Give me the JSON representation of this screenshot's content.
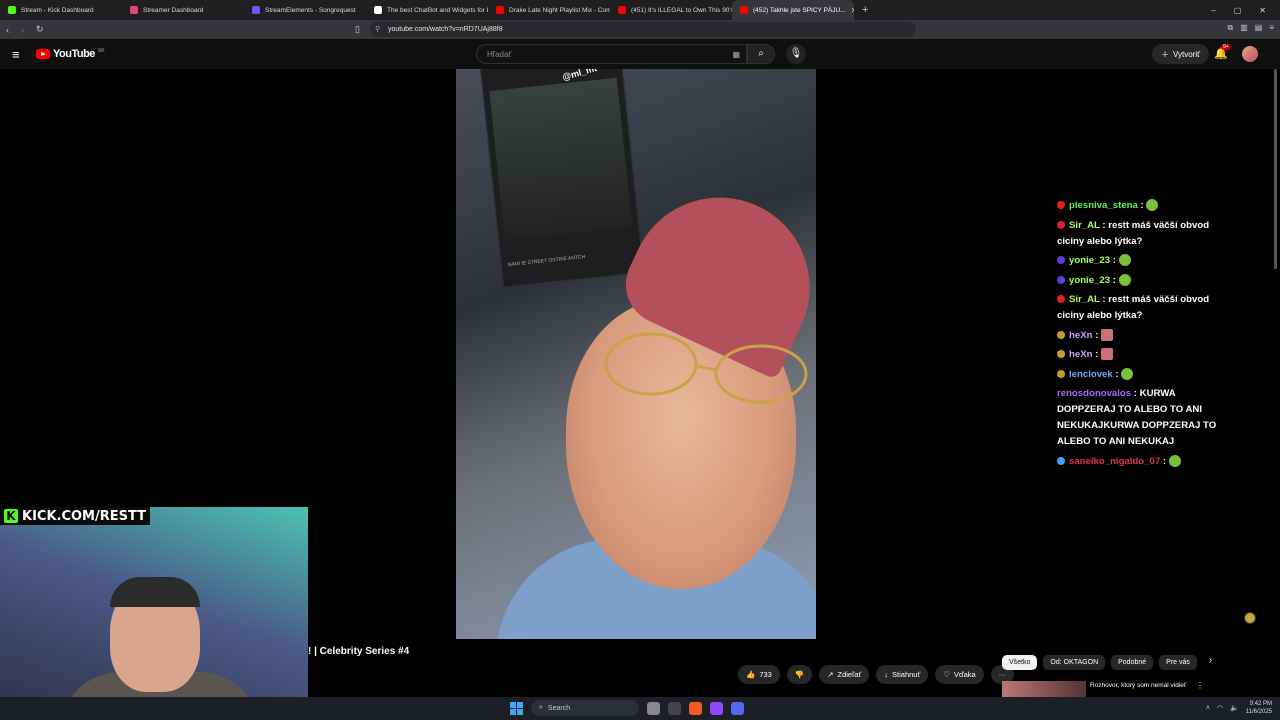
{
  "browser": {
    "tabs": [
      {
        "label": "Stream - Kick Dashboard",
        "color": "#53fc18"
      },
      {
        "label": "Streamer Dashboard",
        "color": "#e0457b"
      },
      {
        "label": "StreamElements - Songrequest",
        "color": "#6b5bff"
      },
      {
        "label": "The best ChatBot and Widgets for K...",
        "color": "#ffffff"
      },
      {
        "label": "Drake Late Night Playlist Mix - Comp...",
        "color": "#ff0000"
      },
      {
        "label": "(451) It's ILLEGAL to Own This 90's H...",
        "color": "#ff0000"
      },
      {
        "label": "(452) Takhle jste SPICY PÁJU...",
        "color": "#ff0000",
        "active": true
      }
    ],
    "new_tab": "+",
    "url": "youtube.com/watch?v=nRD7UAj88f8",
    "window_controls": [
      "–",
      "▢",
      "✕"
    ]
  },
  "youtube": {
    "logo_text": "YouTube",
    "country": "SK",
    "search_placeholder": "Hľadať",
    "create_label": "Vytvoriť",
    "notif_count": "9+",
    "video_title": "! | Celebrity Series #4",
    "story_tag": "@ml_mt",
    "story_caption": "NAMI IE STREET OSTRIE ANTCH",
    "like_count": "733",
    "share_label": "Zdieľať",
    "download_label": "Stiahnuť",
    "thanks_label": "Vďaka",
    "more_label": "···",
    "chips": [
      "Všetko",
      "Od: OKTAGON",
      "Podobné",
      "Pre vás"
    ],
    "rec_title": "Rozhovor, ktorý som nemal vidieť"
  },
  "chat": [
    {
      "user": "plesniva_stena",
      "user_color": "#5ef05e",
      "badge_color": "#e02020",
      "text": "",
      "emote": "green"
    },
    {
      "user": "Sir_AL",
      "user_color": "#a8ff60",
      "badge_color": "#e02020",
      "text": "restt máš väčší obvod ciciny alebo lýtka?"
    },
    {
      "user": "yonie_23",
      "user_color": "#a8ff60",
      "badge_color": "#5a3cd6",
      "text": "",
      "emote": "green"
    },
    {
      "user": "yonie_23",
      "user_color": "#a8ff60",
      "badge_color": "#5a3cd6",
      "text": "",
      "emote": "green"
    },
    {
      "user": "Sir_AL",
      "user_color": "#a8ff60",
      "badge_color": "#e02020",
      "text": "restt máš väčší obvod ciciny alebo lýtka?"
    },
    {
      "user": "heXn",
      "user_color": "#c9a1ff",
      "badge_color": "#c89b2a",
      "text": "",
      "emote": "pink"
    },
    {
      "user": "heXn",
      "user_color": "#c9a1ff",
      "badge_color": "#c89b2a",
      "text": "",
      "emote": "pink"
    },
    {
      "user": "lenclovek",
      "user_color": "#6fa8ff",
      "badge_color": "#c89b2a",
      "text": "",
      "emote": "green"
    },
    {
      "user": "renosdonovalos",
      "user_color": "#b368ff",
      "badge_color": "",
      "text": "KURWA DOPPZERAJ TO ALEBO TO ANI NEKUKAJKURWA DOPPZERAJ TO ALEBO TO ANI NEKUKAJ"
    },
    {
      "user": "sanelko_nigaldo_07",
      "user_color": "#e0354a",
      "badge_color": "#3aa0ff",
      "text": "",
      "emote": "green"
    }
  ],
  "overlay": {
    "kick_url": "KICK.COM/RESTT",
    "kick_color": "#53fc18"
  },
  "taskbar": {
    "search_label": "Search",
    "time": "9:42 PM",
    "date": "11/6/2025"
  }
}
